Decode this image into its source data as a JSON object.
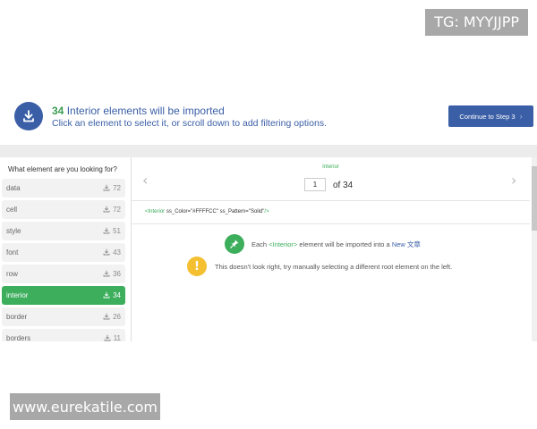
{
  "watermark_top": "TG: MYYJJPP",
  "watermark_bottom": "www.eurekatile.com",
  "header": {
    "count": "34",
    "title_rest": "Interior elements will be imported",
    "subtitle": "Click an element to select it, or scroll down to add filtering options.",
    "continue_label": "Continue to Step 3",
    "continue_chevron": "›"
  },
  "sidebar": {
    "title": "What element are you looking for?",
    "items": [
      {
        "label": "data",
        "count": "72",
        "active": false
      },
      {
        "label": "cell",
        "count": "72",
        "active": false
      },
      {
        "label": "style",
        "count": "51",
        "active": false
      },
      {
        "label": "font",
        "count": "43",
        "active": false
      },
      {
        "label": "row",
        "count": "36",
        "active": false
      },
      {
        "label": "interior",
        "count": "34",
        "active": true
      },
      {
        "label": "border",
        "count": "26",
        "active": false
      },
      {
        "label": "borders",
        "count": "11",
        "active": false
      }
    ]
  },
  "main": {
    "element_name": "Interior",
    "page_value": "1",
    "page_of": "of 34",
    "prev_glyph": "‹",
    "next_glyph": "›",
    "code_tag_open": "<Interior",
    "code_attrs": " ss_Color=\"#FFFFCC\" ss_Pattern=\"Solid\"",
    "code_tag_close": "/>",
    "info_prefix": "Each",
    "info_tag": "<Interior>",
    "info_middle": "element will be imported into a",
    "info_target": "New 文章",
    "warning_text": "This doesn't look right, try manually selecting a different root element on the left.",
    "warning_glyph": "!"
  },
  "colors": {
    "accent_blue": "#3b5fa6",
    "accent_green": "#3cae5c",
    "warning_yellow": "#f4c032"
  },
  "icons": {
    "header": "import-download-icon",
    "sidebar_count": "download-icon",
    "info": "pin-icon",
    "warning": "warning-icon"
  }
}
